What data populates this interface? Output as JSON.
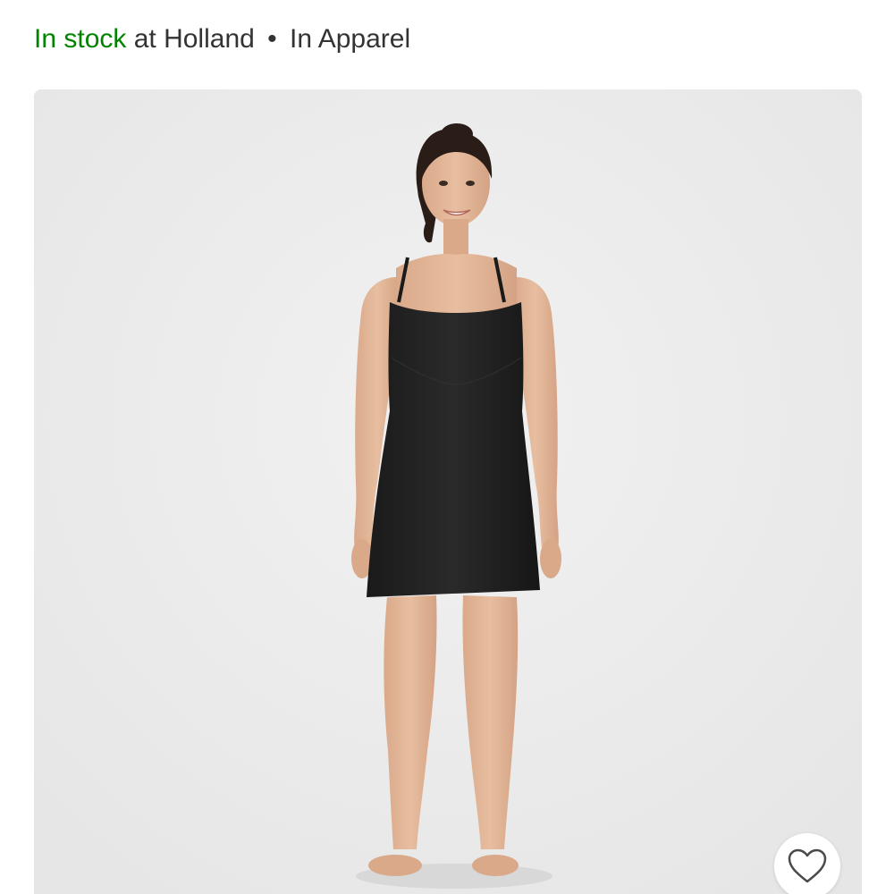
{
  "availability": {
    "status": "In stock",
    "store_text": "at Holland",
    "separator": "•",
    "department": "In Apparel"
  },
  "product": {
    "image_alt": "Black sleeveless active dress",
    "favorite_icon": "heart-outline-icon"
  },
  "colors": {
    "in_stock": "#008300",
    "text": "#333333",
    "image_bg": "#ececec"
  }
}
